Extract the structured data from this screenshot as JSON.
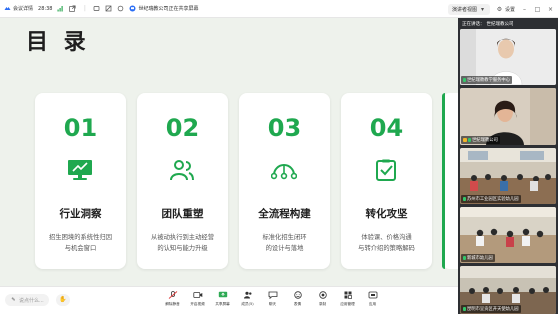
{
  "topbar": {
    "meeting_status": "会议详情",
    "time": "28:38",
    "host_label": "世纪瑞教公司正在共享屏幕",
    "speaker_view": "演讲者视图",
    "settings": "设置"
  },
  "slide": {
    "title": "目 录",
    "accent_color": "#1fa84f",
    "cards": [
      {
        "num": "01",
        "icon": "presentation-chart-icon",
        "title": "行业洞察",
        "desc": [
          "招生困境的系统性归因",
          "与机会窗口"
        ]
      },
      {
        "num": "02",
        "icon": "team-people-icon",
        "title": "团队重塑",
        "desc": [
          "从被动执行到主动经营",
          "的认知与能力升级"
        ]
      },
      {
        "num": "03",
        "icon": "process-arc-icon",
        "title": "全流程构建",
        "desc": [
          "标准化招生闭环",
          "的设计与落地"
        ]
      },
      {
        "num": "04",
        "icon": "checklist-icon",
        "title": "转化攻坚",
        "desc": [
          "体验课、价格沟通",
          "与转介绍的策略解码"
        ]
      }
    ]
  },
  "sidebar": {
    "speaking_label": "正在讲话：",
    "speaking_name": "世纪瑞教公司",
    "tiles": [
      {
        "label": "世纪瑞教教学服务中心"
      },
      {
        "label": "世纪瑞教公司"
      },
      {
        "label": "苏州市工业园区实验幼儿园"
      },
      {
        "label": "新城市幼儿园"
      },
      {
        "label": "昆明市呈贡区开天使幼儿园"
      }
    ]
  },
  "bottombar": {
    "chat_placeholder": "说点什么...",
    "tools": [
      {
        "icon": "mic-off-icon",
        "label": "解除静音"
      },
      {
        "icon": "camera-icon",
        "label": "开启视频"
      },
      {
        "icon": "share-screen-icon",
        "label": "共享屏幕"
      },
      {
        "icon": "members-icon",
        "label": "成员(5)"
      },
      {
        "icon": "chat-icon",
        "label": "聊天"
      },
      {
        "icon": "react-icon",
        "label": "表情"
      },
      {
        "icon": "record-icon",
        "label": "录制"
      },
      {
        "icon": "apps-icon",
        "label": "应用管理"
      },
      {
        "icon": "more-icon",
        "label": "应用"
      }
    ]
  }
}
